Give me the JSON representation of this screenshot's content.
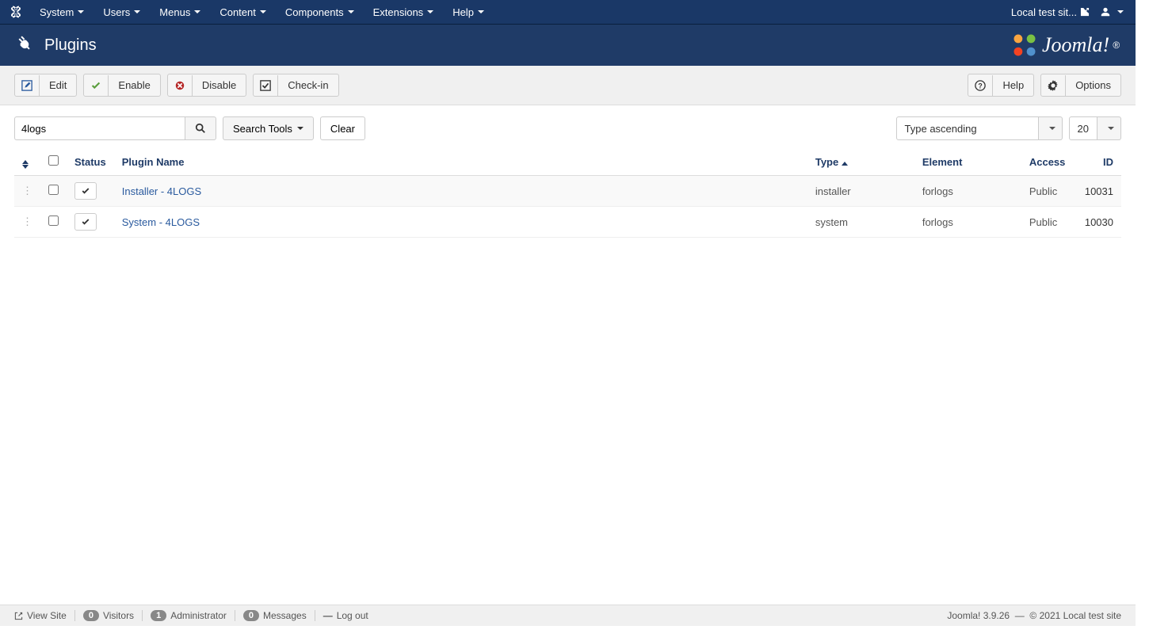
{
  "topmenu": {
    "items": [
      "System",
      "Users",
      "Menus",
      "Content",
      "Components",
      "Extensions",
      "Help"
    ],
    "site_name": "Local test sit..."
  },
  "header": {
    "title": "Plugins",
    "brand": "Joomla!"
  },
  "toolbar": {
    "edit": "Edit",
    "enable": "Enable",
    "disable": "Disable",
    "checkin": "Check-in",
    "help": "Help",
    "options": "Options"
  },
  "filter": {
    "search_value": "4logs",
    "search_tools": "Search Tools",
    "clear": "Clear",
    "sort": "Type ascending",
    "limit": "20"
  },
  "columns": {
    "status": "Status",
    "name": "Plugin Name",
    "type": "Type",
    "element": "Element",
    "access": "Access",
    "id": "ID"
  },
  "rows": [
    {
      "name": "Installer - 4LOGS",
      "type": "installer",
      "element": "forlogs",
      "access": "Public",
      "id": "10031"
    },
    {
      "name": "System - 4LOGS",
      "type": "system",
      "element": "forlogs",
      "access": "Public",
      "id": "10030"
    }
  ],
  "footer": {
    "view_site": "View Site",
    "visitors_count": "0",
    "visitors": "Visitors",
    "admins_count": "1",
    "admins": "Administrator",
    "messages_count": "0",
    "messages": "Messages",
    "logout": "Log out",
    "version": "Joomla! 3.9.26",
    "copyright": "© 2021 Local test site"
  }
}
